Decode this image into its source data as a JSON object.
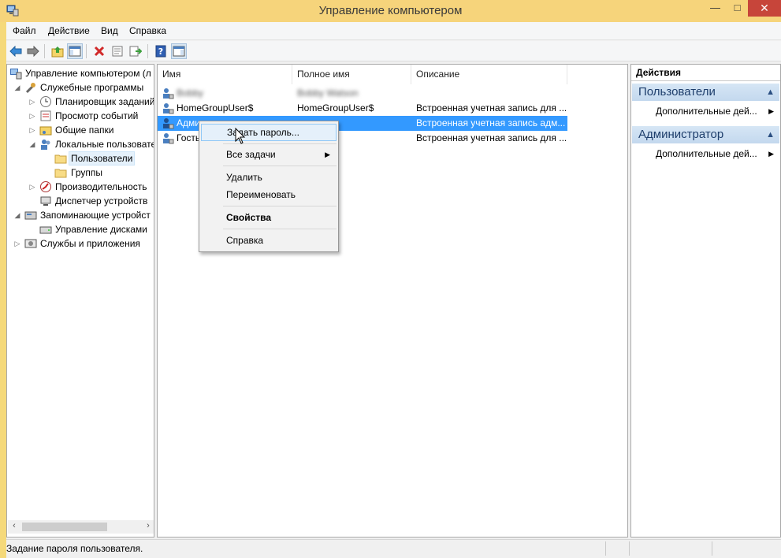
{
  "window": {
    "title": "Управление компьютером",
    "min_glyph": "—",
    "max_glyph": "□",
    "close_glyph": "✕"
  },
  "menu": [
    "Файл",
    "Действие",
    "Вид",
    "Справка"
  ],
  "toolbar": {
    "buttons": [
      "back-arrow-icon",
      "forward-arrow-icon",
      "up-folder-icon",
      "show-hide-tree-icon",
      "delete-icon",
      "properties-icon",
      "export-list-icon",
      "help-icon",
      "show-hide-action-pane-icon"
    ]
  },
  "tree": {
    "root": "Управление компьютером (л",
    "system_tools": "Служебные программы",
    "task_scheduler": "Планировщик заданий",
    "event_viewer": "Просмотр событий",
    "shared_folders": "Общие папки",
    "local_users": "Локальные пользовате",
    "users": "Пользователи",
    "groups": "Группы",
    "performance": "Производительность",
    "device_manager": "Диспетчер устройств",
    "storage": "Запоминающие устройст",
    "disk_management": "Управление дисками",
    "services": "Службы и приложения"
  },
  "list": {
    "columns": [
      "Имя",
      "Полное имя",
      "Описание"
    ],
    "rows": [
      {
        "name": "Bobby",
        "full_name": "Bobby Watson",
        "description": ""
      },
      {
        "name": "HomeGroupUser$",
        "full_name": "HomeGroupUser$",
        "description": "Встроенная учетная запись для ..."
      },
      {
        "name": "Администратор",
        "full_name": "",
        "description": "Встроенная учетная запись адм..."
      },
      {
        "name": "Гость",
        "full_name": "",
        "description": "Встроенная учетная запись для ..."
      }
    ]
  },
  "context_menu": {
    "set_password": "Задать пароль...",
    "all_tasks": "Все задачи",
    "delete": "Удалить",
    "rename": "Переименовать",
    "properties": "Свойства",
    "help": "Справка"
  },
  "actions": {
    "title": "Действия",
    "section1": "Пользователи",
    "section1_item": "Дополнительные дей...",
    "section2": "Администратор",
    "section2_item": "Дополнительные дей..."
  },
  "status": {
    "text": "Задание пароля пользователя."
  },
  "colors": {
    "titlebar": "#f6d47b",
    "selection": "#3399ff",
    "close_button": "#c7453a"
  }
}
